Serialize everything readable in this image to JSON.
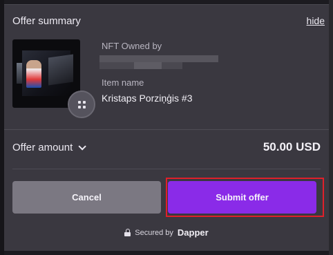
{
  "summary": {
    "title": "Offer summary",
    "hide_label": "hide"
  },
  "nft": {
    "owned_label": "NFT Owned by",
    "item_label": "Item name",
    "item_name": "Kristaps Porziņģis #3"
  },
  "offer": {
    "amount_label": "Offer amount",
    "amount_value": "50.00 USD"
  },
  "actions": {
    "cancel_label": "Cancel",
    "submit_label": "Submit offer"
  },
  "footer": {
    "secured_prefix": "Secured by",
    "brand": "Dapper"
  },
  "colors": {
    "panel": "#3a3840",
    "submit": "#8a2be8",
    "cancel": "#7b7882",
    "highlight": "#e0202a"
  },
  "icons": [
    "grid-icon",
    "chevron-down-icon",
    "lock-icon"
  ]
}
